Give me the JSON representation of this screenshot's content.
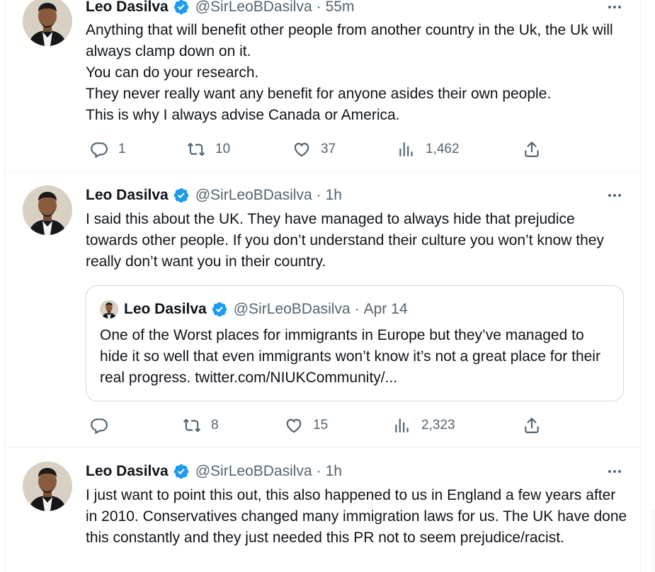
{
  "tweets": [
    {
      "name": "Leo Dasilva",
      "handle": "@SirLeoBDasilva",
      "time": "55m",
      "text": "Anything that will benefit other people from another country in the Uk, the Uk will always clamp down on it.\nYou can do your research.\nThey never really want any benefit for anyone asides their own people.\nThis is why I always advise Canada or America.",
      "replies": "1",
      "retweets": "10",
      "likes": "37",
      "views": "1,462"
    },
    {
      "name": "Leo Dasilva",
      "handle": "@SirLeoBDasilva",
      "time": "1h",
      "text": "I said this about the UK. They have managed to always hide that prejudice towards other people. If you don’t understand their culture you won’t know they really don’t want you in their country.",
      "quote": {
        "name": "Leo Dasilva",
        "handle": "@SirLeoBDasilva",
        "time": "Apr 14",
        "text": "One of the Worst places for immigrants in Europe but they’ve managed to hide it so well that even immigrants won’t know it’s not a great place for their real progress. twitter.com/NIUKCommunity/..."
      },
      "replies": "",
      "retweets": "8",
      "likes": "15",
      "views": "2,323"
    },
    {
      "name": "Leo Dasilva",
      "handle": "@SirLeoBDasilva",
      "time": "1h",
      "text": "I just want to point this out, this also happened to us in England a few years after in 2010. Conservatives changed many immigration laws for us. The UK have done this constantly and they just needed this PR not to seem prejudice/racist."
    }
  ],
  "separator": "·",
  "icons": {
    "verified": "verified-badge-icon",
    "more": "more-dots-icon",
    "reply": "reply-icon",
    "retweet": "retweet-icon",
    "like": "heart-icon",
    "views": "views-chart-icon",
    "share": "share-icon"
  },
  "colors": {
    "verified_blue": "#1d9bf0",
    "secondary_text": "#536471",
    "border": "#eff3f4",
    "text": "#0f1419"
  }
}
